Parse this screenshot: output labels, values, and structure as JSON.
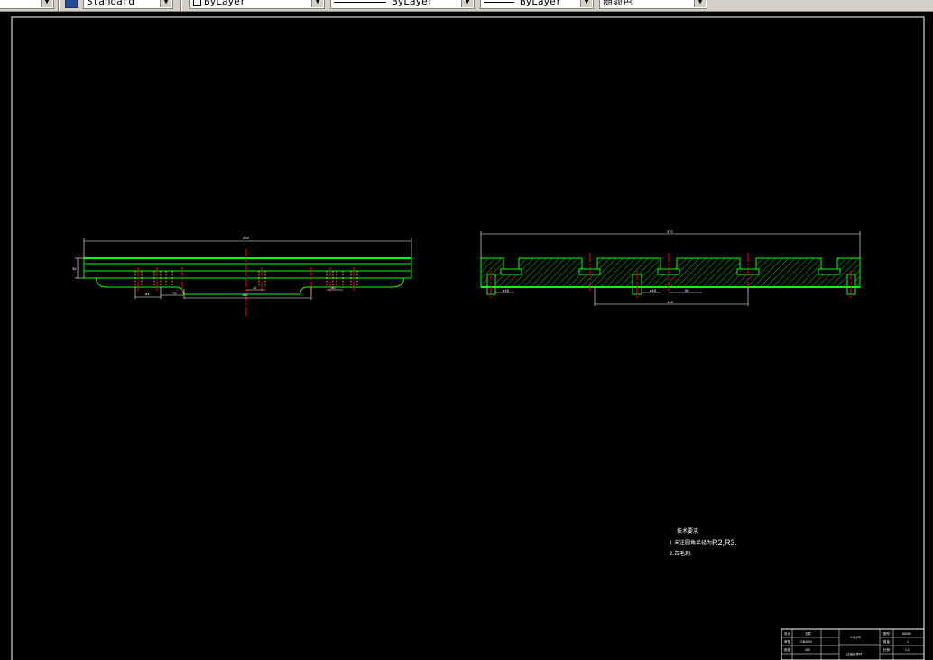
{
  "toolbar": {
    "textstyle_value": "Standard",
    "layer_value": "ByLayer",
    "linetype_value": "ByLayer",
    "lineweight_value": "ByLayer",
    "color_value": "随颜色"
  },
  "front_view": {
    "overall_dim": "378",
    "height_dim": "36",
    "dim_a": "64",
    "dim_b": "78",
    "dim_c": "180",
    "dim_d": "12",
    "dim_e": "32"
  },
  "section_view": {
    "overall_dim": "370",
    "slot_dim_left": "ø18",
    "slot_dim_mid": "ø18",
    "pitch_dim": "56",
    "span_dim": "148"
  },
  "notes": {
    "title": "技术要求",
    "line1_prefix": "1.未注圆角半径为",
    "line1_value": "R2,R3.",
    "line2": "2.去毛刺."
  },
  "title_block": {
    "r1c1": "设计",
    "r1c2": "文件",
    "r2c1": "审核",
    "r2c2": "GB4004",
    "r3c1": "批准",
    "r3c2": "450",
    "name": "XX公司",
    "part": "过渡板零件",
    "code_label": "图号",
    "code_value": "56285",
    "qty_label": "数量",
    "qty_value": "1",
    "scale_label": "比例",
    "scale_value": "1:1"
  },
  "colors": {
    "outline": "#00ff00",
    "hatch": "#00ff00",
    "centerline": "#ff0000",
    "dimension": "#ffffff",
    "background": "#000000"
  }
}
